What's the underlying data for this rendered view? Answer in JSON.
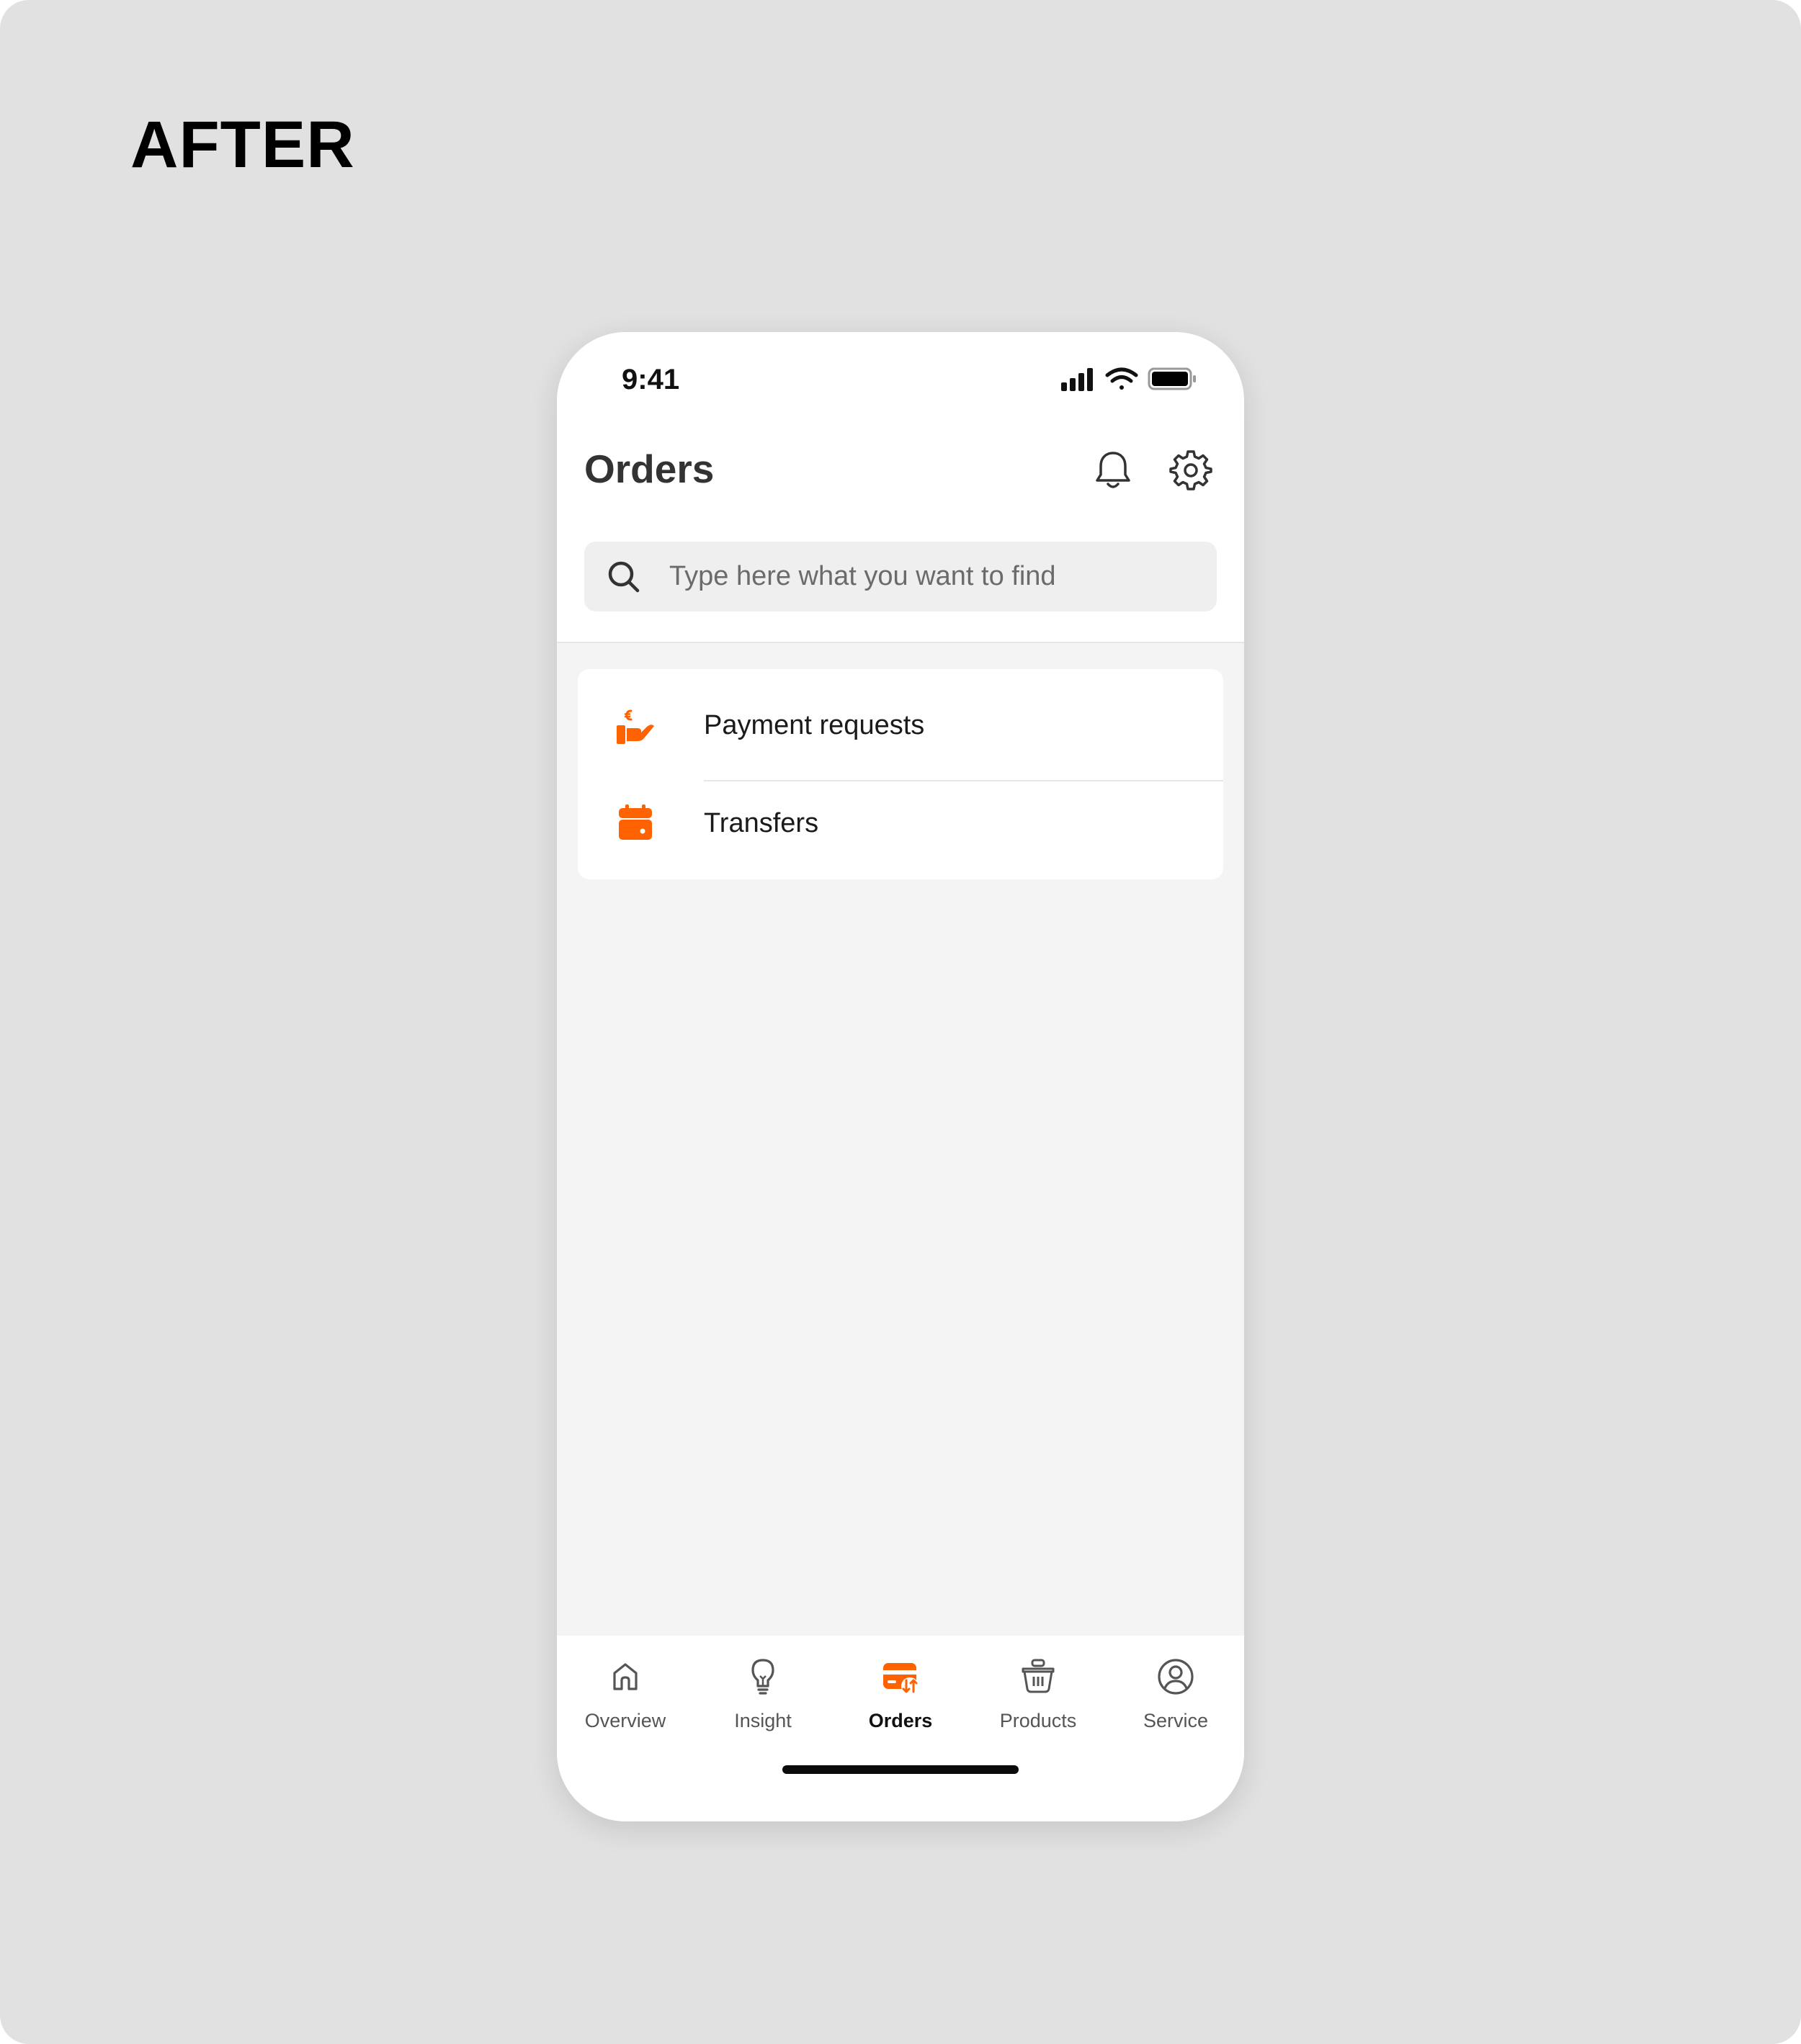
{
  "heading": "AFTER",
  "status_bar": {
    "time": "9:41",
    "icons": [
      "cellular-signal-icon",
      "wifi-icon",
      "battery-icon"
    ]
  },
  "header": {
    "title": "Orders",
    "icons": [
      "bell-icon",
      "gear-icon"
    ]
  },
  "search": {
    "placeholder": "Type here what you want to find",
    "value": "",
    "icon": "search-icon"
  },
  "menu": {
    "items": [
      {
        "label": "Payment requests",
        "icon": "hand-euro-icon"
      },
      {
        "label": "Transfers",
        "icon": "calendar-icon"
      }
    ]
  },
  "tabbar": {
    "active": "Orders",
    "tabs": [
      {
        "label": "Overview",
        "icon": "home-icon"
      },
      {
        "label": "Insight",
        "icon": "lightbulb-icon"
      },
      {
        "label": "Orders",
        "icon": "card-transfer-icon"
      },
      {
        "label": "Products",
        "icon": "basket-icon"
      },
      {
        "label": "Service",
        "icon": "user-circle-icon"
      }
    ]
  },
  "colors": {
    "accent": "#ff6200",
    "background": "#e1e1e1",
    "screen_background": "#f4f4f4",
    "text_primary": "#333333"
  }
}
